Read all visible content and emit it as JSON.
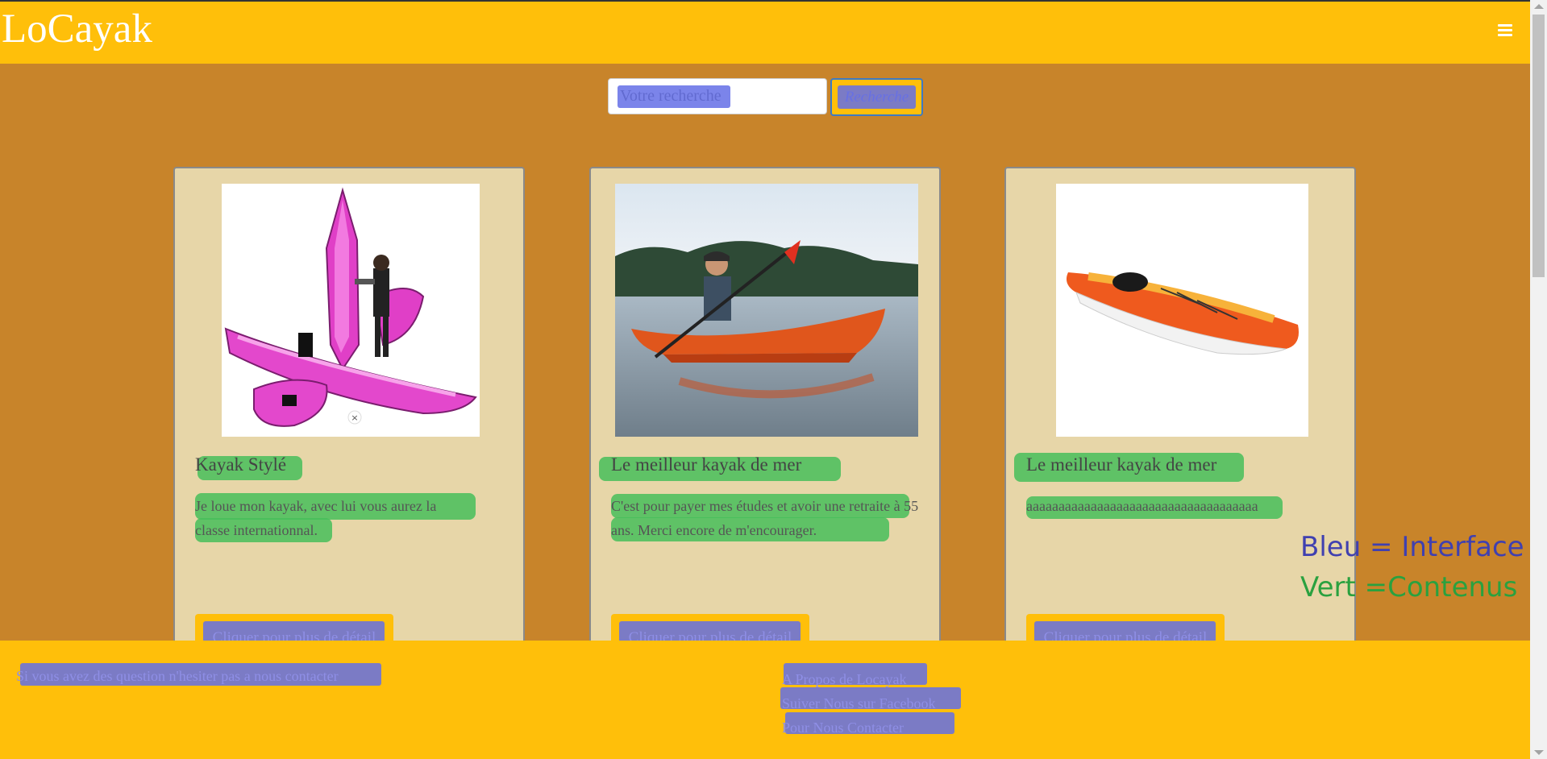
{
  "header": {
    "brand": "LoCayak",
    "menu_icon": "hamburger-menu-icon"
  },
  "search": {
    "placeholder": "Votre recherche",
    "button_label": "Recherche"
  },
  "cards": [
    {
      "title": "Kayak Stylé",
      "description": "Je loue mon kayak, avec lui vous aurez la classe internationnal.",
      "button_label": "Cliquer pour plus de détail",
      "image": "pink inflatable kayak with person",
      "close_glyph": "×"
    },
    {
      "title": "Le meilleur kayak de mer",
      "description": "C'est pour payer mes études et avoir une retraite à 55 ans. Merci encore de m'encourager.",
      "button_label": "Cliquer pour plus de détail",
      "image": "person paddling orange kayak on lake"
    },
    {
      "title": "Le meilleur kayak de mer",
      "description": "aaaaaaaaaaaaaaaaaaaaaaaaaaaaaaaaaaaa",
      "button_label": "Cliquer pour plus de détail",
      "image": "orange sea kayak"
    }
  ],
  "footer": {
    "contact_text": "Si vous avez des question n'hesiter pas a nous contacter",
    "links": [
      "A Propos de Locayak",
      "Suiver Nous sur Facebook",
      "Pour Nous Contacter"
    ]
  },
  "legend": {
    "blue": "Bleu = Interface",
    "green": "Vert =Contenus"
  },
  "colors": {
    "header": "#ffbf0a",
    "background": "#c8842a",
    "card": "#e7d6a8",
    "annotation_blue": "#646ee6",
    "annotation_green": "#46be5a"
  }
}
